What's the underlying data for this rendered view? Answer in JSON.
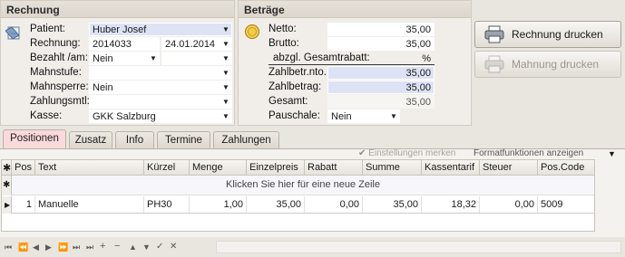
{
  "rechnung": {
    "title": "Rechnung",
    "patient_label": "Patient:",
    "patient_value": "Huber Josef",
    "rechnung_label": "Rechnung:",
    "rechnung_nr": "2014033",
    "rechnung_datum": "24.01.2014",
    "bezahlt_label": "Bezahlt /am:",
    "bezahlt_value": "Nein",
    "bezahlt_am": "",
    "mahnstufe_label": "Mahnstufe:",
    "mahnstufe_value": "",
    "mahnsperre_label": "Mahnsperre:",
    "mahnsperre_value": "Nein",
    "zahlungsmtl_label": "Zahlungsmtl:",
    "zahlungsmtl_value": "",
    "kasse_label": "Kasse:",
    "kasse_value": "GKK Salzburg"
  },
  "betraege": {
    "title": "Beträge",
    "netto_label": "Netto:",
    "netto_value": "35,00",
    "brutto_label": "Brutto:",
    "brutto_value": "35,00",
    "rabatt_label": "abzgl. Gesamtrabatt:",
    "rabatt_value": "%",
    "zahlbetr_nto_label": "Zahlbetr.nto.",
    "zahlbetr_nto_value": "35,00",
    "zahlbetrag_label": "Zahlbetrag:",
    "zahlbetrag_value": "35,00",
    "gesamt_label": "Gesamt:",
    "gesamt_value": "35,00",
    "pauschale_label": "Pauschale:",
    "pauschale_value": "Nein"
  },
  "actions": {
    "rechnung_drucken": "Rechnung drucken",
    "mahnung_drucken": "Mahnung drucken"
  },
  "tabs": [
    "Positionen",
    "Zusatz",
    "Info",
    "Termine",
    "Zahlungen"
  ],
  "toolbar": {
    "einstellungen": "Einstellungen merken",
    "formatfunktionen": "Formatfunktionen anzeigen"
  },
  "grid": {
    "columns": [
      "Pos",
      "Text",
      "Kürzel",
      "Menge",
      "Einzelpreis",
      "Rabatt",
      "Summe",
      "Kassentarif",
      "Steuer",
      "Pos.Code"
    ],
    "new_row_hint": "Klicken Sie hier für eine neue Zeile",
    "rows": [
      [
        "1",
        "Manuelle",
        "PH30",
        "1,00",
        "35,00",
        "0,00",
        "35,00",
        "18,32",
        "0,00",
        "5009"
      ]
    ]
  },
  "colors": {
    "accent_selected": "#dde3f4",
    "active_tab": "#f9d9d9"
  }
}
